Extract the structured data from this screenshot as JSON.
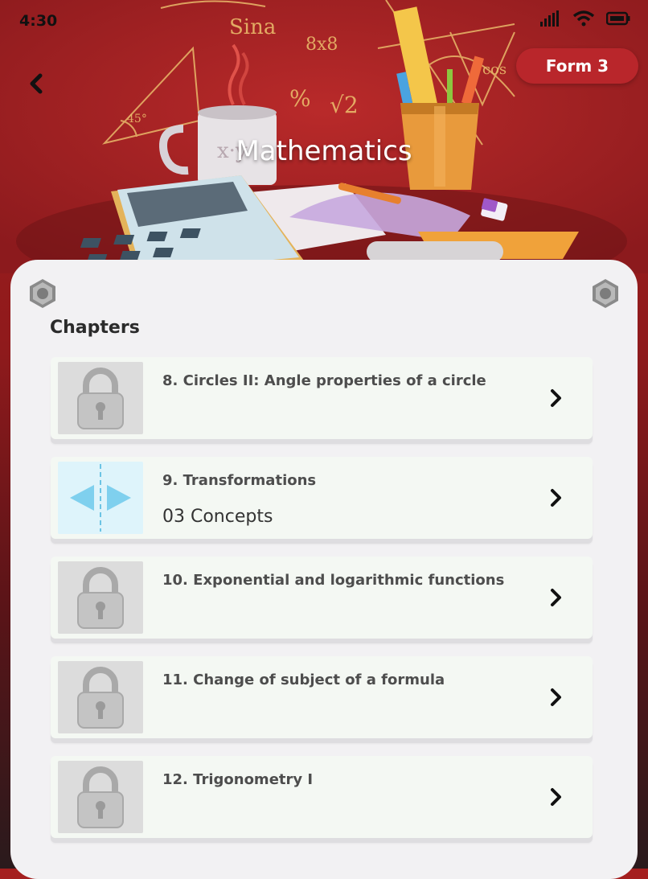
{
  "status": {
    "time": "4:30"
  },
  "header": {
    "form_label": "Form 3",
    "subject": "Mathematics"
  },
  "doodles": {
    "sina": "Sina",
    "eight_x_eight": "8x8",
    "percent": "%",
    "sqrt2": "√2",
    "angle45": "45°",
    "cos": "cos",
    "xy": "x·y"
  },
  "chapters_heading": "Chapters",
  "chapters": [
    {
      "title": "8. Circles II: Angle properties of a circle",
      "subtitle": "",
      "locked": true,
      "icon": "lock-icon"
    },
    {
      "title": "9. Transformations",
      "subtitle": "03 Concepts",
      "locked": false,
      "icon": "reflection-icon"
    },
    {
      "title": "10. Exponential and logarithmic functions",
      "subtitle": "",
      "locked": true,
      "icon": "lock-icon"
    },
    {
      "title": "11. Change of subject of a formula",
      "subtitle": "",
      "locked": true,
      "icon": "lock-icon"
    },
    {
      "title": "12. Trigonometry I",
      "subtitle": "",
      "locked": true,
      "icon": "lock-icon"
    }
  ],
  "colors": {
    "brand_red": "#a51f1f",
    "badge_red": "#b9262b",
    "card_bg": "#f4f8f3",
    "panel_bg": "#f2f1f3"
  }
}
